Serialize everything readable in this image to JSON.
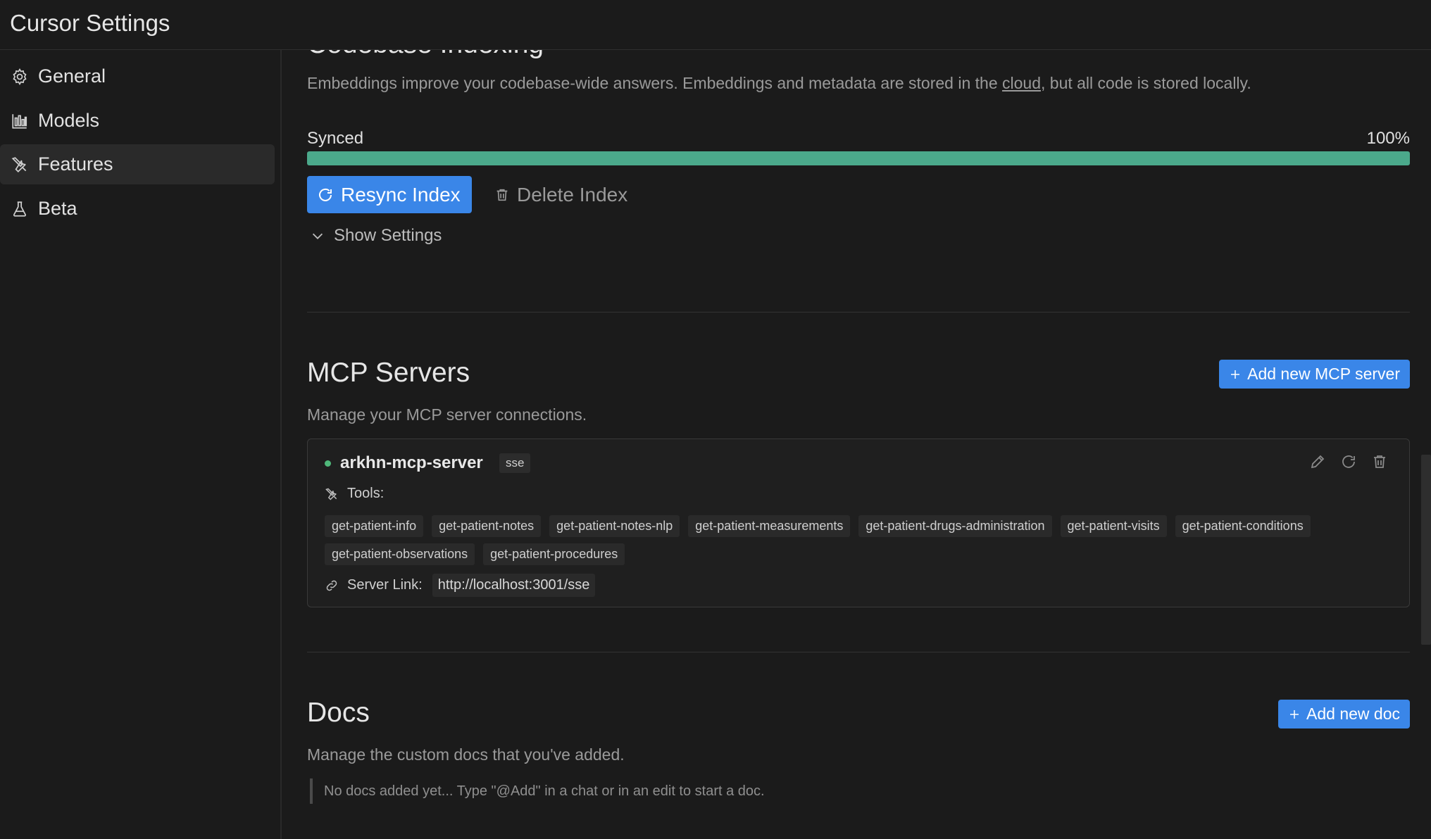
{
  "app": {
    "title": "Cursor Settings"
  },
  "sidebar": {
    "items": [
      {
        "label": "General",
        "icon": "gear-icon",
        "active": false
      },
      {
        "label": "Models",
        "icon": "bar-chart-icon",
        "active": false
      },
      {
        "label": "Features",
        "icon": "tools-icon",
        "active": true
      },
      {
        "label": "Beta",
        "icon": "flask-icon",
        "active": false
      }
    ]
  },
  "indexing": {
    "title": "Codebase Indexing",
    "desc_before": "Embeddings improve your codebase-wide answers. Embeddings and metadata are stored in the ",
    "desc_link": "cloud",
    "desc_after": ", but all code is stored locally.",
    "status": "Synced",
    "percent_label": "100%",
    "progress": 1.0,
    "resync_label": "Resync Index",
    "delete_label": "Delete Index",
    "show_settings_label": "Show Settings"
  },
  "mcp": {
    "title": "MCP Servers",
    "add_label": "Add new MCP server",
    "desc": "Manage your MCP server connections.",
    "server": {
      "name": "arkhn-mcp-server",
      "type": "sse",
      "status_color": "#4fb87a",
      "tools_label": "Tools:",
      "tools": [
        "get-patient-info",
        "get-patient-notes",
        "get-patient-notes-nlp",
        "get-patient-measurements",
        "get-patient-drugs-administration",
        "get-patient-visits",
        "get-patient-conditions",
        "get-patient-observations",
        "get-patient-procedures"
      ],
      "link_label": "Server Link:",
      "link": "http://localhost:3001/sse"
    }
  },
  "docs": {
    "title": "Docs",
    "add_label": "Add new doc",
    "desc": "Manage the custom docs that you've added.",
    "empty": "No docs added yet... Type \"@Add\" in a chat or in an edit to start a doc."
  },
  "colors": {
    "accent": "#3a86e8",
    "progress": "#4ba98b",
    "background": "#1b1b1b"
  }
}
